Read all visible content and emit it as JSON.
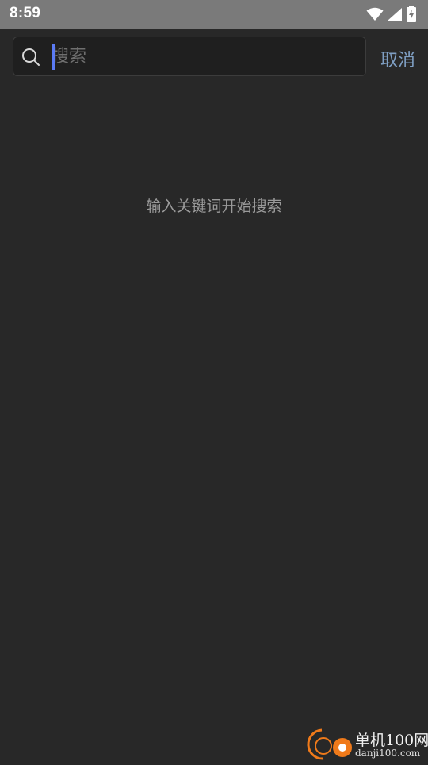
{
  "status_bar": {
    "time": "8:59",
    "icons": [
      "wifi-icon",
      "cell-signal-icon",
      "battery-charging-icon"
    ]
  },
  "search": {
    "placeholder": "搜索",
    "value": "",
    "icon": "search-icon",
    "cancel_label": "取消"
  },
  "main": {
    "empty_hint": "输入关键词开始搜索"
  },
  "watermark": {
    "title": "单机100网",
    "url": "danji100.com"
  },
  "colors": {
    "background": "#282828",
    "status_bar": "#7a7a7a",
    "search_box": "#1f1f1f",
    "accent_caret": "#5b7bf5",
    "cancel_text": "#7f9fc3",
    "hint_text": "#9a9a9a",
    "watermark_orange": "#f07a1a"
  }
}
